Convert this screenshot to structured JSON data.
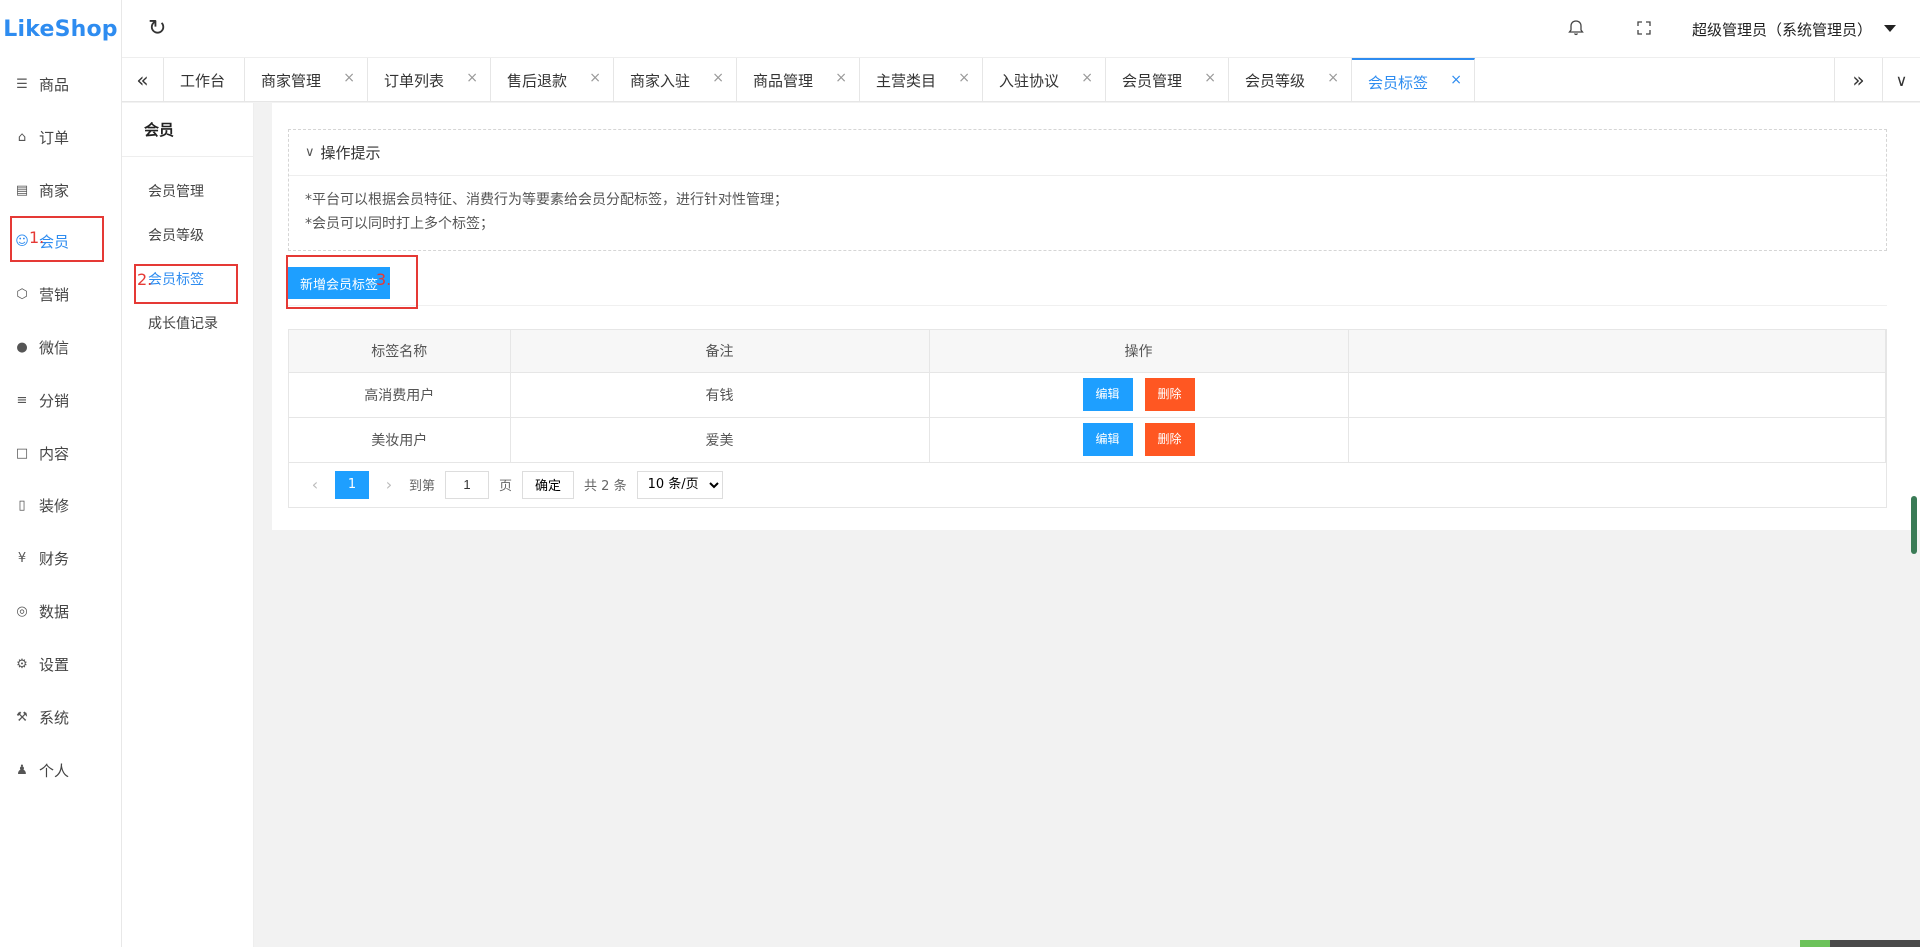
{
  "app": {
    "logo": "LikeShop",
    "username": "超级管理员（系统管理员）"
  },
  "left_nav": [
    {
      "label": "商品",
      "icon": "cart-icon"
    },
    {
      "label": "订单",
      "icon": "bell-icon"
    },
    {
      "label": "商家",
      "icon": "store-icon"
    },
    {
      "label": "会员",
      "icon": "user-icon",
      "active": true
    },
    {
      "label": "营销",
      "icon": "box-icon"
    },
    {
      "label": "微信",
      "icon": "wechat-icon"
    },
    {
      "label": "分销",
      "icon": "layers-icon"
    },
    {
      "label": "内容",
      "icon": "book-icon"
    },
    {
      "label": "装修",
      "icon": "phone-icon"
    },
    {
      "label": "财务",
      "icon": "yen-icon"
    },
    {
      "label": "数据",
      "icon": "globe-icon"
    },
    {
      "label": "设置",
      "icon": "gear-icon"
    },
    {
      "label": "系统",
      "icon": "tools-icon"
    },
    {
      "label": "个人",
      "icon": "person-icon"
    }
  ],
  "tabs": [
    {
      "label": "工作台",
      "closable": false
    },
    {
      "label": "商家管理",
      "closable": true
    },
    {
      "label": "订单列表",
      "closable": true
    },
    {
      "label": "售后退款",
      "closable": true
    },
    {
      "label": "商家入驻",
      "closable": true
    },
    {
      "label": "商品管理",
      "closable": true
    },
    {
      "label": "主营类目",
      "closable": true
    },
    {
      "label": "入驻协议",
      "closable": true
    },
    {
      "label": "会员管理",
      "closable": true
    },
    {
      "label": "会员等级",
      "closable": true
    },
    {
      "label": "会员标签",
      "closable": true,
      "active": true
    }
  ],
  "sub_nav": {
    "title": "会员",
    "items": [
      {
        "label": "会员管理"
      },
      {
        "label": "会员等级"
      },
      {
        "label": "会员标签",
        "active": true
      },
      {
        "label": "成长值记录"
      }
    ]
  },
  "tips": {
    "title": "操作提示",
    "lines": [
      "*平台可以根据会员特征、消费行为等要素给会员分配标签，进行针对性管理；",
      "*会员可以同时打上多个标签；"
    ]
  },
  "add_button": "新增会员标签",
  "table": {
    "headers": [
      "标签名称",
      "备注",
      "操作"
    ],
    "rows": [
      {
        "name": "高消费用户",
        "remark": "有钱"
      },
      {
        "name": "美妆用户",
        "remark": "爱美"
      }
    ],
    "edit_label": "编辑",
    "delete_label": "删除"
  },
  "pager": {
    "current": "1",
    "goto_label": "到第",
    "goto_value": "1",
    "page_unit": "页",
    "confirm": "确定",
    "total": "共 2 条",
    "page_size": "10 条/页"
  },
  "annotations": [
    "1.",
    "2.",
    "3."
  ],
  "colors": {
    "primary": "#1e9fff",
    "link": "#2e8cf0",
    "danger": "#ff5722",
    "annotation": "#e53935"
  }
}
